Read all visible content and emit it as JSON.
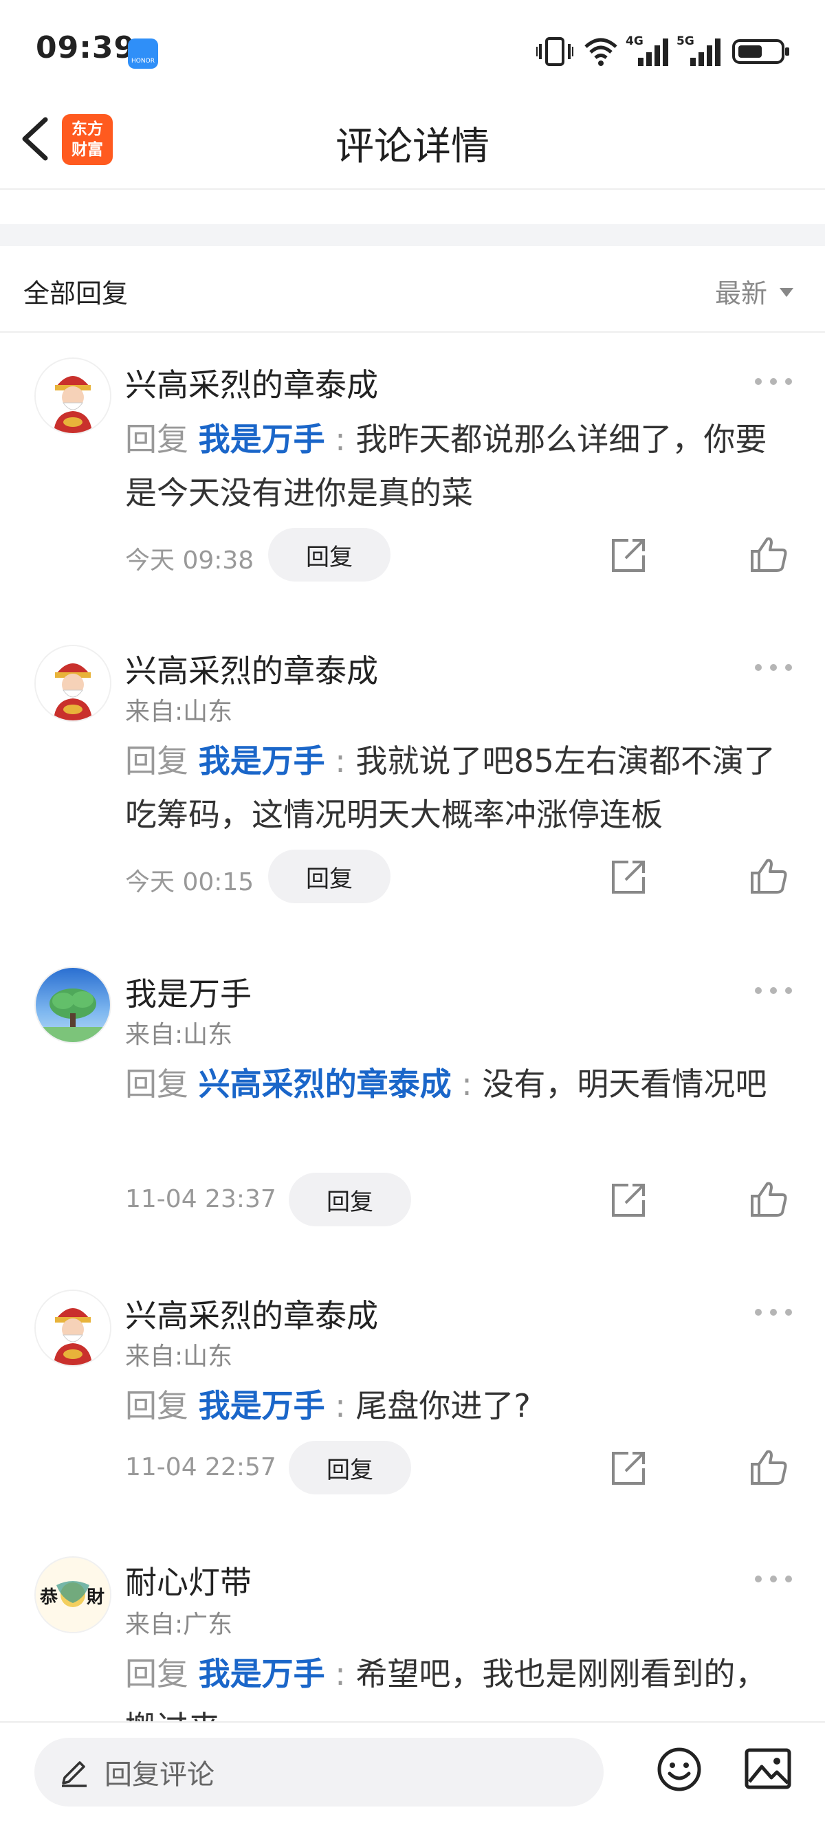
{
  "status_bar": {
    "time": "09:39",
    "net1": "4G",
    "net2": "5G"
  },
  "header": {
    "title": "评论详情",
    "logo_line1": "东方",
    "logo_line2": "财富"
  },
  "sort_bar": {
    "label": "全部回复",
    "sort": "最新"
  },
  "reply_prefix": "回复",
  "reply_button_label": "回复",
  "comments": [
    {
      "user": "兴高采烈的章泰成",
      "location": "",
      "target": "我是万手",
      "text": "我昨天都说那么详细了，你要是今天没有进你是真的菜",
      "time": "今天 09:38"
    },
    {
      "user": "兴高采烈的章泰成",
      "location": "来自:山东",
      "target": "我是万手",
      "text": "我就说了吧85左右演都不演了吃筹码，这情况明天大概率冲涨停连板",
      "time": "今天 00:15"
    },
    {
      "user": "我是万手",
      "location": "来自:山东",
      "target": "兴高采烈的章泰成",
      "text": "没有，明天看情况吧",
      "time": "11-04 23:37"
    },
    {
      "user": "兴高采烈的章泰成",
      "location": "来自:山东",
      "target": "我是万手",
      "text": "尾盘你进了?",
      "time": "11-04 22:57"
    },
    {
      "user": "耐心灯带",
      "location": "来自:广东",
      "target": "我是万手",
      "text": "希望吧，我也是刚刚看到的，搬过来",
      "time": ""
    }
  ],
  "avatar_text": {
    "comment_5": "恭喜發財"
  },
  "bottom_bar": {
    "placeholder": "回复评论"
  },
  "colors": {
    "accent_blue": "#1a66c9",
    "logo_orange": "#ff5a1f"
  }
}
